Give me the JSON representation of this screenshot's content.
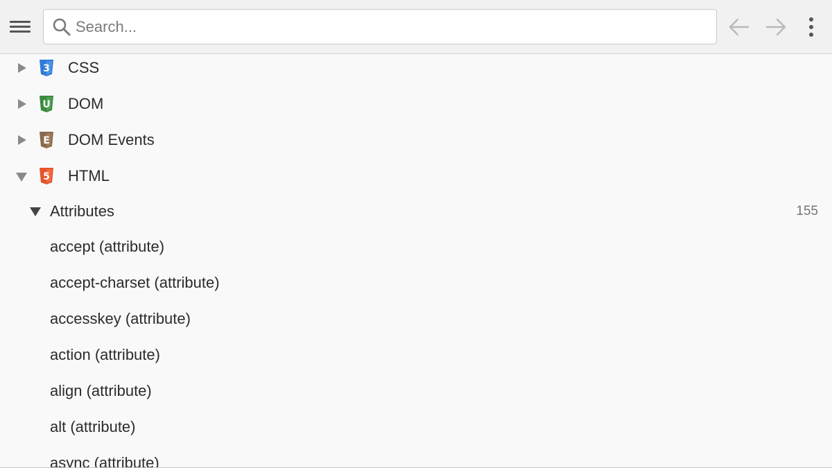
{
  "search": {
    "placeholder": "Search..."
  },
  "icons": {
    "menu": "hamburger-menu-icon",
    "search": "magnifier-icon",
    "back": "arrow-left-icon",
    "forward": "arrow-right-icon",
    "more": "vertical-dots-icon"
  },
  "tree": {
    "docsets": [
      {
        "label": "CSS",
        "badge": "3",
        "color": "#2f7bd8",
        "expanded": false
      },
      {
        "label": "DOM",
        "badge": "U",
        "color": "#3b8a3e",
        "expanded": false
      },
      {
        "label": "DOM Events",
        "badge": "E",
        "color": "#8a6a4b",
        "expanded": false
      },
      {
        "label": "HTML",
        "badge": "5",
        "color": "#e4532b",
        "expanded": true
      }
    ],
    "group": {
      "label": "Attributes",
      "count": "155",
      "expanded": true
    },
    "entries": [
      "accept (attribute)",
      "accept-charset (attribute)",
      "accesskey (attribute)",
      "action (attribute)",
      "align (attribute)",
      "alt (attribute)",
      "async (attribute)"
    ]
  },
  "colors": {
    "toolbar_bg": "#f1f1f1",
    "list_bg": "#f9f9f9",
    "text": "#2b2b2b",
    "muted": "#777777"
  }
}
